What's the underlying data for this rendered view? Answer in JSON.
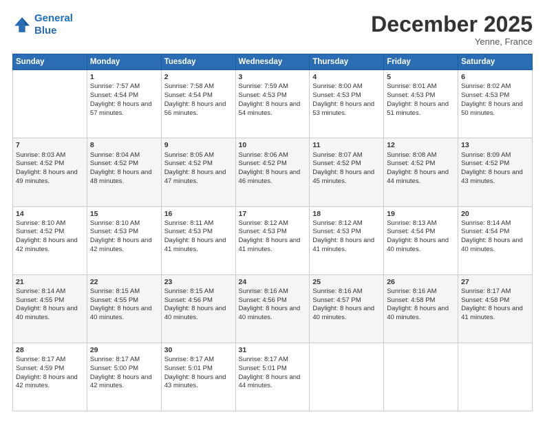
{
  "header": {
    "logo_line1": "General",
    "logo_line2": "Blue",
    "month_title": "December 2025",
    "subtitle": "Yenne, France"
  },
  "days_header": [
    "Sunday",
    "Monday",
    "Tuesday",
    "Wednesday",
    "Thursday",
    "Friday",
    "Saturday"
  ],
  "weeks": [
    [
      {
        "num": "",
        "sunrise": "",
        "sunset": "",
        "daylight": ""
      },
      {
        "num": "1",
        "sunrise": "Sunrise: 7:57 AM",
        "sunset": "Sunset: 4:54 PM",
        "daylight": "Daylight: 8 hours and 57 minutes."
      },
      {
        "num": "2",
        "sunrise": "Sunrise: 7:58 AM",
        "sunset": "Sunset: 4:54 PM",
        "daylight": "Daylight: 8 hours and 56 minutes."
      },
      {
        "num": "3",
        "sunrise": "Sunrise: 7:59 AM",
        "sunset": "Sunset: 4:53 PM",
        "daylight": "Daylight: 8 hours and 54 minutes."
      },
      {
        "num": "4",
        "sunrise": "Sunrise: 8:00 AM",
        "sunset": "Sunset: 4:53 PM",
        "daylight": "Daylight: 8 hours and 53 minutes."
      },
      {
        "num": "5",
        "sunrise": "Sunrise: 8:01 AM",
        "sunset": "Sunset: 4:53 PM",
        "daylight": "Daylight: 8 hours and 51 minutes."
      },
      {
        "num": "6",
        "sunrise": "Sunrise: 8:02 AM",
        "sunset": "Sunset: 4:53 PM",
        "daylight": "Daylight: 8 hours and 50 minutes."
      }
    ],
    [
      {
        "num": "7",
        "sunrise": "Sunrise: 8:03 AM",
        "sunset": "Sunset: 4:52 PM",
        "daylight": "Daylight: 8 hours and 49 minutes."
      },
      {
        "num": "8",
        "sunrise": "Sunrise: 8:04 AM",
        "sunset": "Sunset: 4:52 PM",
        "daylight": "Daylight: 8 hours and 48 minutes."
      },
      {
        "num": "9",
        "sunrise": "Sunrise: 8:05 AM",
        "sunset": "Sunset: 4:52 PM",
        "daylight": "Daylight: 8 hours and 47 minutes."
      },
      {
        "num": "10",
        "sunrise": "Sunrise: 8:06 AM",
        "sunset": "Sunset: 4:52 PM",
        "daylight": "Daylight: 8 hours and 46 minutes."
      },
      {
        "num": "11",
        "sunrise": "Sunrise: 8:07 AM",
        "sunset": "Sunset: 4:52 PM",
        "daylight": "Daylight: 8 hours and 45 minutes."
      },
      {
        "num": "12",
        "sunrise": "Sunrise: 8:08 AM",
        "sunset": "Sunset: 4:52 PM",
        "daylight": "Daylight: 8 hours and 44 minutes."
      },
      {
        "num": "13",
        "sunrise": "Sunrise: 8:09 AM",
        "sunset": "Sunset: 4:52 PM",
        "daylight": "Daylight: 8 hours and 43 minutes."
      }
    ],
    [
      {
        "num": "14",
        "sunrise": "Sunrise: 8:10 AM",
        "sunset": "Sunset: 4:52 PM",
        "daylight": "Daylight: 8 hours and 42 minutes."
      },
      {
        "num": "15",
        "sunrise": "Sunrise: 8:10 AM",
        "sunset": "Sunset: 4:53 PM",
        "daylight": "Daylight: 8 hours and 42 minutes."
      },
      {
        "num": "16",
        "sunrise": "Sunrise: 8:11 AM",
        "sunset": "Sunset: 4:53 PM",
        "daylight": "Daylight: 8 hours and 41 minutes."
      },
      {
        "num": "17",
        "sunrise": "Sunrise: 8:12 AM",
        "sunset": "Sunset: 4:53 PM",
        "daylight": "Daylight: 8 hours and 41 minutes."
      },
      {
        "num": "18",
        "sunrise": "Sunrise: 8:12 AM",
        "sunset": "Sunset: 4:53 PM",
        "daylight": "Daylight: 8 hours and 41 minutes."
      },
      {
        "num": "19",
        "sunrise": "Sunrise: 8:13 AM",
        "sunset": "Sunset: 4:54 PM",
        "daylight": "Daylight: 8 hours and 40 minutes."
      },
      {
        "num": "20",
        "sunrise": "Sunrise: 8:14 AM",
        "sunset": "Sunset: 4:54 PM",
        "daylight": "Daylight: 8 hours and 40 minutes."
      }
    ],
    [
      {
        "num": "21",
        "sunrise": "Sunrise: 8:14 AM",
        "sunset": "Sunset: 4:55 PM",
        "daylight": "Daylight: 8 hours and 40 minutes."
      },
      {
        "num": "22",
        "sunrise": "Sunrise: 8:15 AM",
        "sunset": "Sunset: 4:55 PM",
        "daylight": "Daylight: 8 hours and 40 minutes."
      },
      {
        "num": "23",
        "sunrise": "Sunrise: 8:15 AM",
        "sunset": "Sunset: 4:56 PM",
        "daylight": "Daylight: 8 hours and 40 minutes."
      },
      {
        "num": "24",
        "sunrise": "Sunrise: 8:16 AM",
        "sunset": "Sunset: 4:56 PM",
        "daylight": "Daylight: 8 hours and 40 minutes."
      },
      {
        "num": "25",
        "sunrise": "Sunrise: 8:16 AM",
        "sunset": "Sunset: 4:57 PM",
        "daylight": "Daylight: 8 hours and 40 minutes."
      },
      {
        "num": "26",
        "sunrise": "Sunrise: 8:16 AM",
        "sunset": "Sunset: 4:58 PM",
        "daylight": "Daylight: 8 hours and 40 minutes."
      },
      {
        "num": "27",
        "sunrise": "Sunrise: 8:17 AM",
        "sunset": "Sunset: 4:58 PM",
        "daylight": "Daylight: 8 hours and 41 minutes."
      }
    ],
    [
      {
        "num": "28",
        "sunrise": "Sunrise: 8:17 AM",
        "sunset": "Sunset: 4:59 PM",
        "daylight": "Daylight: 8 hours and 42 minutes."
      },
      {
        "num": "29",
        "sunrise": "Sunrise: 8:17 AM",
        "sunset": "Sunset: 5:00 PM",
        "daylight": "Daylight: 8 hours and 42 minutes."
      },
      {
        "num": "30",
        "sunrise": "Sunrise: 8:17 AM",
        "sunset": "Sunset: 5:01 PM",
        "daylight": "Daylight: 8 hours and 43 minutes."
      },
      {
        "num": "31",
        "sunrise": "Sunrise: 8:17 AM",
        "sunset": "Sunset: 5:01 PM",
        "daylight": "Daylight: 8 hours and 44 minutes."
      },
      {
        "num": "",
        "sunrise": "",
        "sunset": "",
        "daylight": ""
      },
      {
        "num": "",
        "sunrise": "",
        "sunset": "",
        "daylight": ""
      },
      {
        "num": "",
        "sunrise": "",
        "sunset": "",
        "daylight": ""
      }
    ]
  ]
}
